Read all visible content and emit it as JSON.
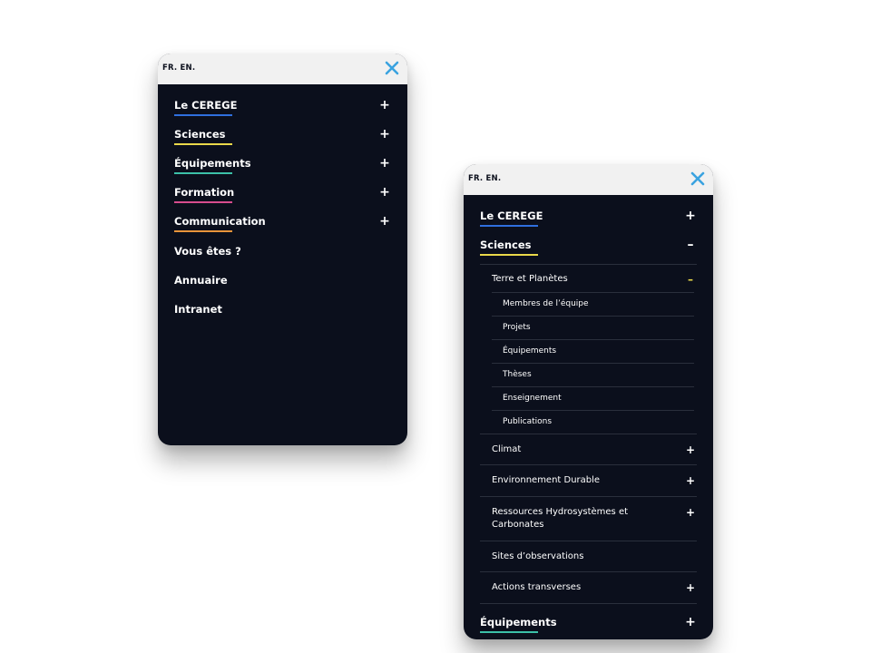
{
  "colors": {
    "panel_bg": "#0b0f1c",
    "topbar_bg": "#f1f1f1",
    "close_icon": "#3aa3e0",
    "divider": "#2a2f3c",
    "underline_le_cerege": "#2f6fde",
    "underline_sciences": "#e9d84a",
    "underline_equipements": "#3cc0a8",
    "underline_formation": "#d74c8e",
    "underline_communication": "#e8943a",
    "accent_minus": "#e9d84a"
  },
  "panel_left": {
    "lang_label": "FR. EN.",
    "close_icon": "close-icon",
    "menu": [
      {
        "label": "Le CEREGE",
        "toggle": "+"
      },
      {
        "label": "Sciences",
        "toggle": "+"
      },
      {
        "label": "Équipements",
        "toggle": "+"
      },
      {
        "label": "Formation",
        "toggle": "+"
      },
      {
        "label": "Communication",
        "toggle": "+"
      },
      {
        "label": "Vous êtes ?"
      },
      {
        "label": "Annuaire"
      },
      {
        "label": "Intranet"
      }
    ]
  },
  "panel_right": {
    "lang_label": "FR. EN.",
    "close_icon": "close-icon",
    "menu": [
      {
        "label": "Le CEREGE",
        "toggle": "+"
      },
      {
        "label": "Sciences",
        "toggle": "–"
      },
      {
        "label": "Équipements",
        "toggle": "+"
      }
    ],
    "sciences_sub": [
      {
        "label": "Terre et Planètes",
        "toggle": "–"
      },
      {
        "label": "Climat",
        "toggle": "+"
      },
      {
        "label": "Environnement Durable",
        "toggle": "+"
      },
      {
        "label": "Ressources Hydrosystèmes et Carbonates",
        "toggle": "+"
      },
      {
        "label": "Sites d’observations"
      },
      {
        "label": "Actions transverses",
        "toggle": "+"
      }
    ],
    "terre_sub": [
      {
        "label": "Membres de l’équipe"
      },
      {
        "label": "Projets"
      },
      {
        "label": "Équipements"
      },
      {
        "label": "Thèses"
      },
      {
        "label": "Enseignement"
      },
      {
        "label": "Publications"
      }
    ]
  }
}
